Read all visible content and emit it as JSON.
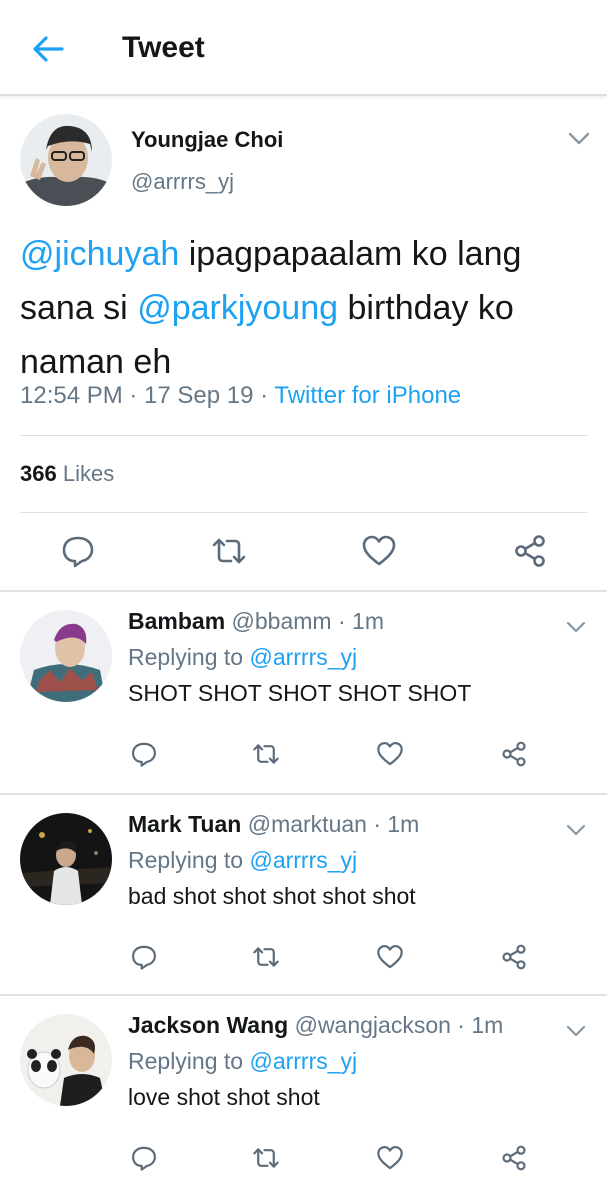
{
  "header": {
    "title": "Tweet"
  },
  "tweet": {
    "author_name": "Youngjae Choi",
    "author_handle": "@arrrrs_yj",
    "text_mention_1": "@jichuyah",
    "text_part_1": " ipagpapaalam ko lang sana si ",
    "text_mention_2": "@parkjyoung",
    "text_part_2": " birthday ko naman eh",
    "time": "12:54 PM · 17 Sep 19 · ",
    "source": "Twitter for iPhone",
    "likes_count": "366",
    "likes_label": " Likes"
  },
  "replies": [
    {
      "name": "Bambam",
      "handle": "@bbamm · 1m",
      "replying_label": "Replying to ",
      "replying_to": "@arrrrs_yj",
      "text": "SHOT SHOT SHOT SHOT SHOT"
    },
    {
      "name": "Mark Tuan",
      "handle": "@marktuan · 1m",
      "replying_label": "Replying to ",
      "replying_to": "@arrrrs_yj",
      "text": "bad shot shot shot shot shot"
    },
    {
      "name": "Jackson Wang",
      "handle": "@wangjackson · 1m",
      "replying_label": "Replying to ",
      "replying_to": "@arrrrs_yj",
      "text": "love shot shot shot"
    }
  ],
  "colors": {
    "accent": "#1da1f2",
    "secondary_text": "#657786",
    "icon": "#5b6b79",
    "divider": "#dcdfe2"
  },
  "icons": [
    "back-arrow-icon",
    "chevron-down-icon",
    "reply-icon",
    "retweet-icon",
    "like-icon",
    "share-icon"
  ]
}
